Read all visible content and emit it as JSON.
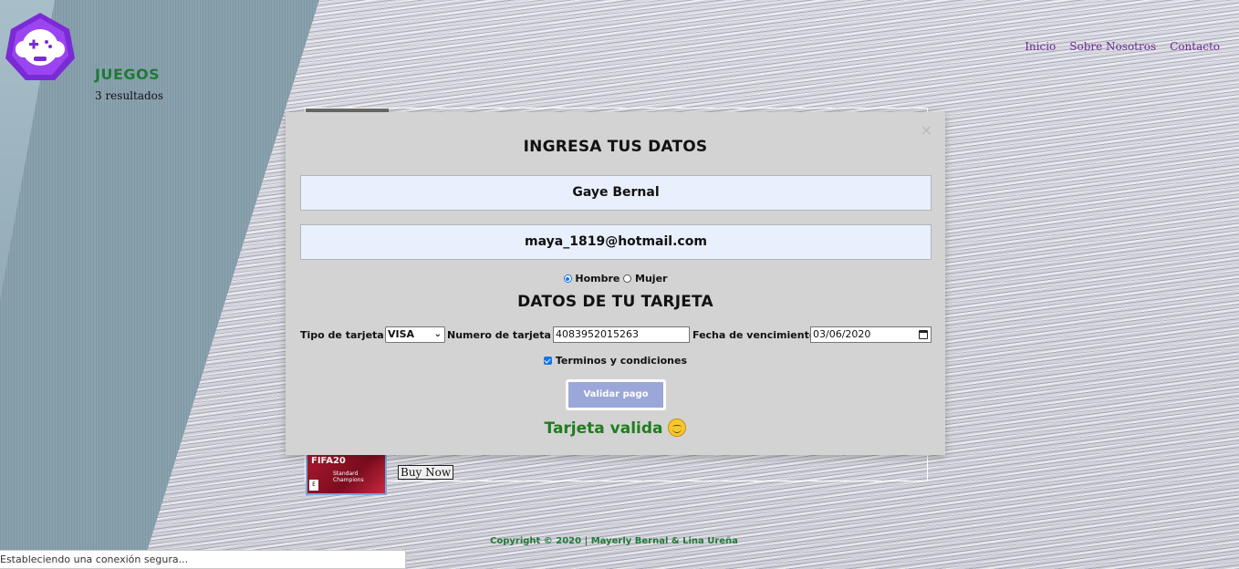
{
  "nav": {
    "items": [
      "Inicio",
      "Sobre Nosotros",
      "Contacto"
    ]
  },
  "section": {
    "title": "JUEGOS",
    "results": "3 resultados"
  },
  "product": {
    "buy_label": "Buy Now",
    "thumb_title": "FIFA20",
    "thumb_edition": "Standard\nChampions"
  },
  "modal": {
    "close": "×",
    "title": "INGRESA TUS DATOS",
    "name_value": "Gaye Bernal",
    "email_value": "maya_1819@hotmail.com",
    "gender": {
      "options": [
        "Hombre",
        "Mujer"
      ],
      "selected": "Hombre"
    },
    "card_title": "DATOS DE TU TARJETA",
    "card_type_label": "Tipo de tarjeta",
    "card_type_value": "VISA",
    "card_number_label": "Numero de tarjeta",
    "card_number_value": "4083952015263",
    "expiry_label": "Fecha de vencimiento",
    "expiry_value": "03/06/2020",
    "terms_label": "Terminos y condiciones",
    "validate_label": "Validar pago",
    "result_text": "Tarjeta valida"
  },
  "footer": {
    "copyright": "Copyright © 2020 | Mayerly Bernal & Lina Ureña"
  },
  "status_bar": {
    "text": "Estableciendo una conexión segura..."
  },
  "colors": {
    "accent_green": "#1f7a35",
    "nav_purple": "#6a2a8f",
    "logo_purple": "#7a2bd6",
    "button_blue": "#9aa7d8"
  }
}
